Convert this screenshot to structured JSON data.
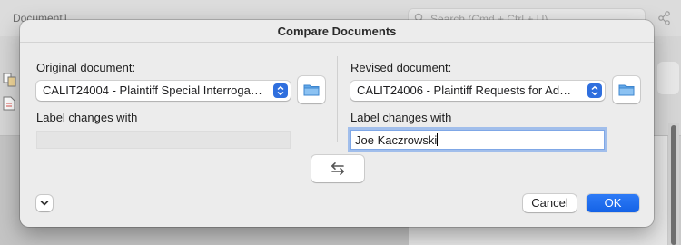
{
  "background": {
    "document_title": "Document1",
    "search_placeholder": "Search (Cmd + Ctrl + U)"
  },
  "dialog": {
    "title": "Compare Documents",
    "original": {
      "label": "Original document:",
      "selected": "CALIT24004 - Plaintiff Special Interrogatori...",
      "label_changes_title": "Label changes with",
      "label_changes_value": ""
    },
    "revised": {
      "label": "Revised document:",
      "selected": "CALIT24006 - Plaintiff Requests for Admissi...",
      "label_changes_title": "Label changes with",
      "label_changes_value": "Joe Kaczrowski"
    },
    "buttons": {
      "cancel": "Cancel",
      "ok": "OK"
    }
  },
  "colors": {
    "accent": "#1a6bf0",
    "focus_ring": "#4887eb"
  },
  "icons": {
    "browse_original": "folder-icon",
    "browse_revised": "folder-icon",
    "swap": "swap-arrows-icon",
    "disclosure": "chevron-down-icon",
    "search": "search-icon"
  }
}
